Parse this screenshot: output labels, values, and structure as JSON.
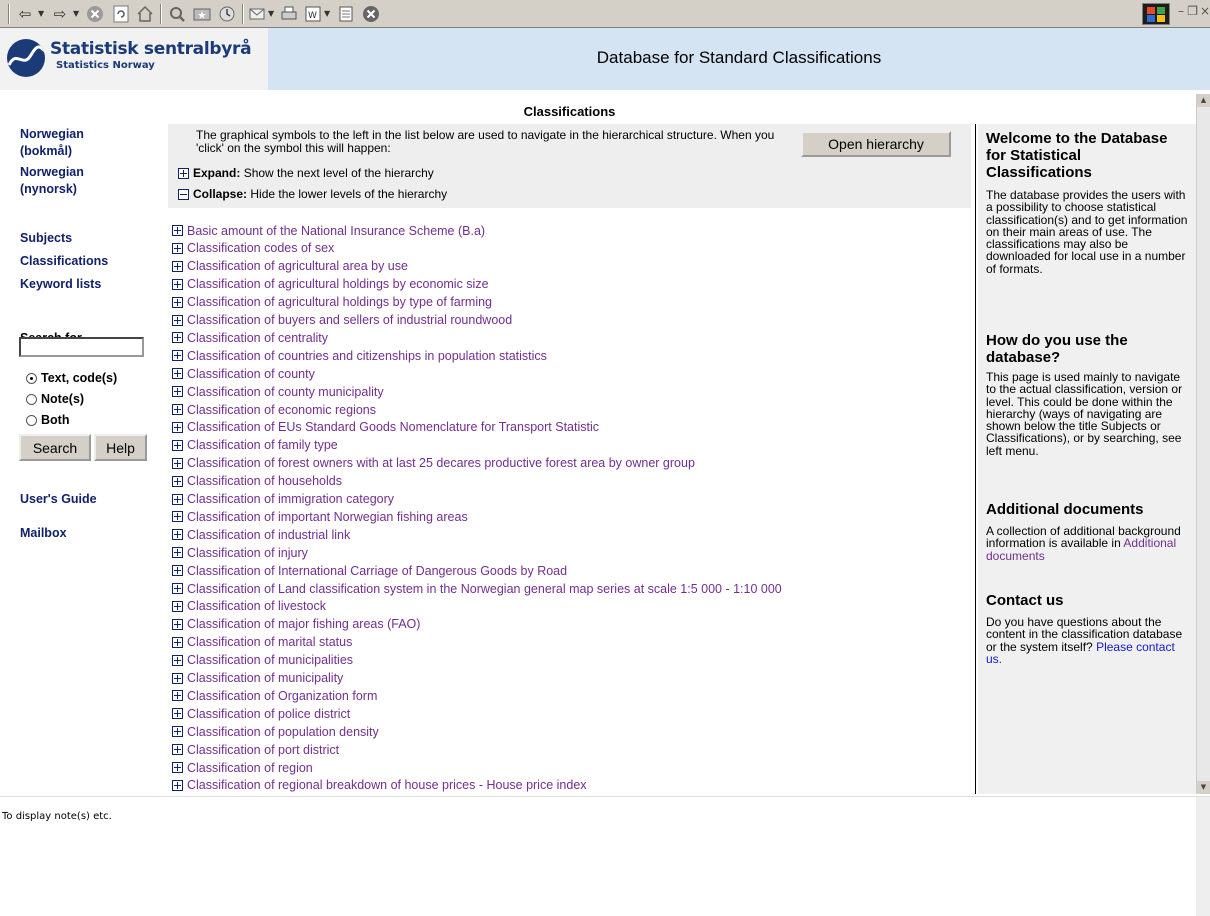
{
  "toolbar": {
    "icons": [
      "back-icon",
      "forward-icon",
      "stop-icon",
      "refresh-icon",
      "home-icon",
      "search-icon",
      "favorites-icon",
      "history-icon",
      "mail-icon",
      "print-icon",
      "edit-icon",
      "discuss-icon",
      "messenger-icon"
    ]
  },
  "header": {
    "logo_line1": "Statistisk sentralbyrå",
    "logo_line2": "Statistics Norway",
    "title": "Database for Standard Classifications",
    "brand_color": "#1a3a78"
  },
  "leftnav": {
    "lang1": "Norwegian (bokmål)",
    "lang2": "Norwegian (nynorsk)",
    "subjects": "Subjects",
    "classifications": "Classifications",
    "keyword_lists": "Keyword lists",
    "search_for": "Search for",
    "search_value": "",
    "radio_text": "Text, code(s)",
    "radio_notes": "Note(s)",
    "radio_both": "Both",
    "selected_radio": "Text, code(s)",
    "search_button": "Search",
    "help_button": "Help",
    "users_guide": "User's Guide",
    "mailbox": "Mailbox"
  },
  "main": {
    "title": "Classifications",
    "info": "The graphical symbols to the left in the list below are used to navigate in the hierarchical structure. When you 'click' on the symbol this will happen:",
    "open_hierarchy": "Open hierarchy",
    "expand_label": "Expand:",
    "expand_text": "Show the next level of the hierarchy",
    "collapse_label": "Collapse:",
    "collapse_text": "Hide the lower levels of the hierarchy",
    "items": [
      "Basic amount of the National Insurance Scheme (B.a)",
      "Classification codes of sex",
      "Classification of agricultural area by use",
      "Classification of agricultural holdings by economic size",
      "Classification of agricultural holdings by type of farming",
      "Classification of buyers and sellers of industrial roundwood",
      "Classification of centrality",
      "Classification of countries and citizenships in population statistics",
      "Classification of county",
      "Classification of county municipality",
      "Classification of economic regions",
      "Classification of EUs Standard Goods Nomenclature for Transport Statistic",
      "Classification of family type",
      "Classification of forest owners with at last 25 decares productive forest area by owner group",
      "Classification of households",
      "Classification of immigration category",
      "Classification of important Norwegian fishing areas",
      "Classification of industrial link",
      "Classification of injury",
      "Classification of International Carriage of Dangerous Goods by Road",
      "Classification of Land classification system in the Norwegian general map series at scale 1:5 000 - 1:10 000",
      "Classification of livestock",
      "Classification of major fishing areas (FAO)",
      "Classification of marital status",
      "Classification of municipalities",
      "Classification of municipality",
      "Classification of Organization form",
      "Classification of police district",
      "Classification of population density",
      "Classification of port district",
      "Classification of region",
      "Classification of regional breakdown of house prices - House price index"
    ]
  },
  "right": {
    "h1": "Welcome to the Database for Statistical Classifications",
    "p1": "The database provides the users with a possibility to choose statistical classification(s) and to get information on their main areas of use. The classifications may also be downloaded for local use in a number of formats.",
    "h2": "How do you use the database?",
    "p2": "This page is used mainly to navigate to the actual classification, version or level. This could be done within the hierarchy (ways of navigating are shown below the title Subjects or Classifications), or by searching, see left menu.",
    "h3": "Additional documents",
    "p3": "A collection of additional background information is available in",
    "p3_link": "Additional documents",
    "h4": "Contact us",
    "p4": "Do you have questions about the content in the classification database or the system itself?",
    "p4_link": "Please contact us."
  },
  "status": {
    "text": "To display note(s) etc."
  }
}
